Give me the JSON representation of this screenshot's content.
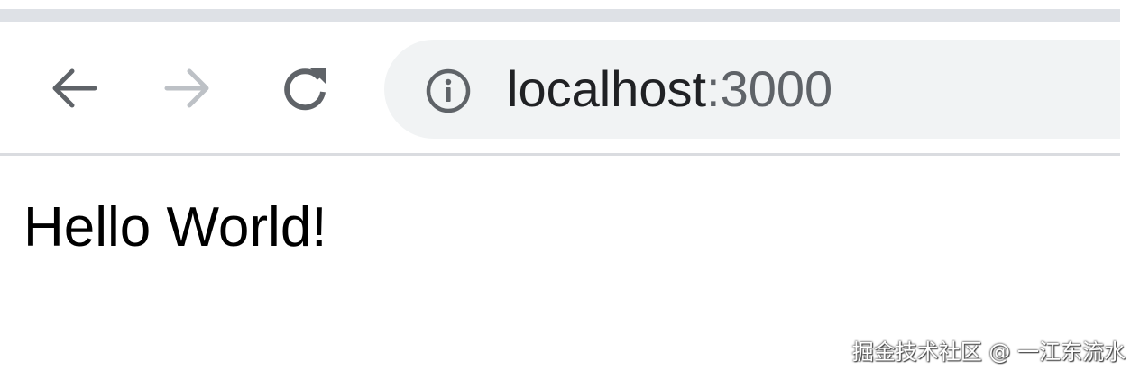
{
  "browser": {
    "toolbar": {
      "back_icon": "arrow-left-icon",
      "forward_icon": "arrow-right-icon",
      "forward_enabled": false,
      "reload_icon": "reload-icon"
    },
    "omnibox": {
      "site_info_icon": "info-circle-icon",
      "url_host": "localhost",
      "url_port": ":3000"
    }
  },
  "page": {
    "body_text": "Hello World!"
  },
  "watermark": {
    "text": "掘金技术社区 @ 一江东流水"
  },
  "colors": {
    "tabstrip": "#dee1e6",
    "omnibox_bg": "#f1f3f4",
    "icon_active": "#5f6368",
    "icon_disabled": "#bdc1c6",
    "url_host": "#202124",
    "url_port": "#5f6368",
    "divider": "#dadce0"
  }
}
